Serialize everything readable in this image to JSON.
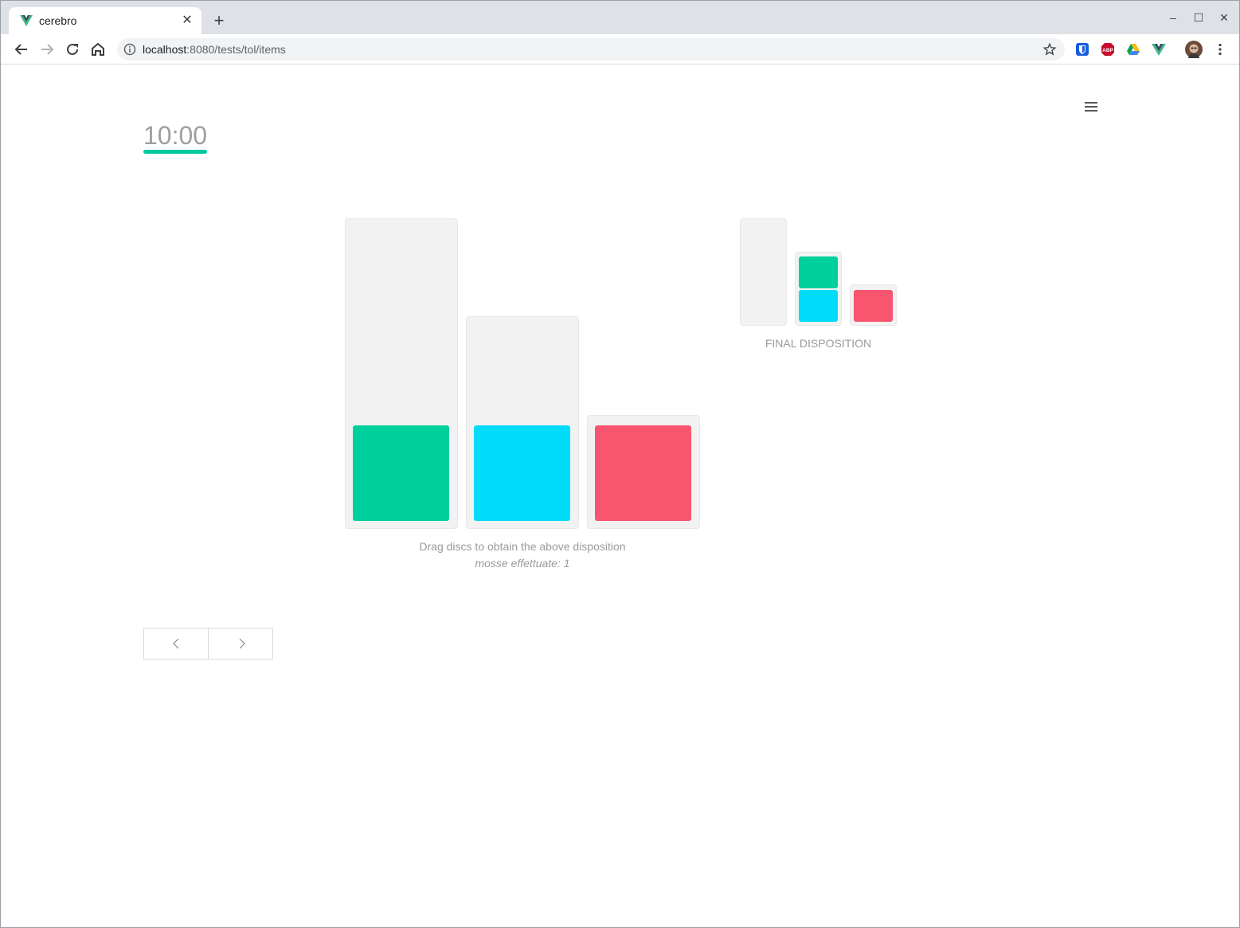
{
  "browser": {
    "tab_title": "cerebro",
    "tab_close": "✕",
    "new_tab": "+",
    "url_host": "localhost",
    "url_path": ":8080/tests/tol/items",
    "window_controls": {
      "minimize": "–",
      "maximize": "☐",
      "close": "✕"
    },
    "extensions": [
      "bitwarden-icon",
      "adblock-plus-icon",
      "google-drive-icon",
      "vue-devtools-icon",
      "profile-avatar"
    ]
  },
  "page": {
    "timer": "10:00",
    "instruction": "Drag discs to obtain the above disposition",
    "moves": "mosse effettuate: 1",
    "final_label": "FINAL DISPOSITION"
  },
  "colors": {
    "green": "#00d09c",
    "cyan": "#00dcfa",
    "red": "#f7566e",
    "accent": "#00c9a0",
    "peg": "#f2f2f2"
  },
  "puzzle": {
    "current_state": [
      {
        "peg": 1,
        "capacity": 3,
        "discs": [
          "green"
        ]
      },
      {
        "peg": 2,
        "capacity": 2,
        "discs": [
          "cyan"
        ]
      },
      {
        "peg": 3,
        "capacity": 1,
        "discs": [
          "red"
        ]
      }
    ],
    "final_state": [
      {
        "peg": 1,
        "capacity": 3,
        "discs": []
      },
      {
        "peg": 2,
        "capacity": 2,
        "discs": [
          "cyan",
          "green"
        ]
      },
      {
        "peg": 3,
        "capacity": 1,
        "discs": [
          "red"
        ]
      }
    ]
  }
}
